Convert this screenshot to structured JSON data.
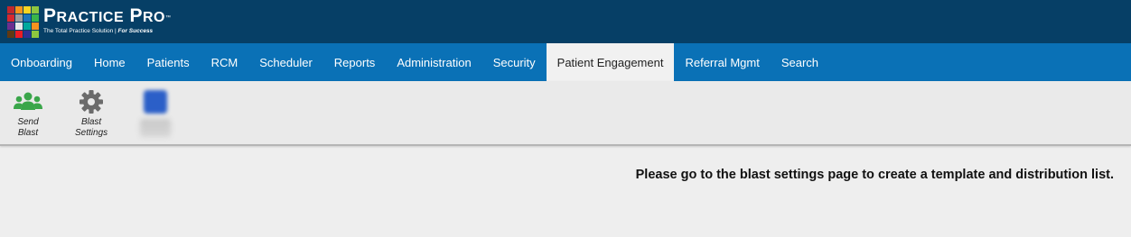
{
  "brand": {
    "title_first_letter": "P",
    "title_rest": "RACTICE",
    "title_second_letter": "P",
    "title_second_rest": "RO",
    "tm": "™",
    "tagline_main": "The Total Practice Solution | ",
    "tagline_em": "For Success",
    "logo_colors": [
      "#c0272d",
      "#f7941d",
      "#f9d423",
      "#8dc63f",
      "#d7282f",
      "#9e9e9e",
      "#1c75bc",
      "#39b54a",
      "#6d2f8f",
      "#e8e8e8",
      "#00a99d",
      "#f7931e",
      "#603913",
      "#ed1c24",
      "#2e3192",
      "#8cc63f"
    ]
  },
  "nav": {
    "items": [
      {
        "label": "Onboarding",
        "active": false
      },
      {
        "label": "Home",
        "active": false
      },
      {
        "label": "Patients",
        "active": false
      },
      {
        "label": "RCM",
        "active": false
      },
      {
        "label": "Scheduler",
        "active": false
      },
      {
        "label": "Reports",
        "active": false
      },
      {
        "label": "Administration",
        "active": false
      },
      {
        "label": "Security",
        "active": false
      },
      {
        "label": "Patient Engagement",
        "active": true
      },
      {
        "label": "Referral Mgmt",
        "active": false
      },
      {
        "label": "Search",
        "active": false
      }
    ]
  },
  "toolbar": {
    "send_blast": {
      "line1": "Send",
      "line2": "Blast",
      "icon": "users-group-icon",
      "color": "#3aa64a"
    },
    "blast_settings": {
      "line1": "Blast",
      "line2": "Settings",
      "icon": "gear-icon",
      "color": "#6b6b6b"
    }
  },
  "main": {
    "message": "Please go to the blast settings page to create a template and distribution list."
  }
}
